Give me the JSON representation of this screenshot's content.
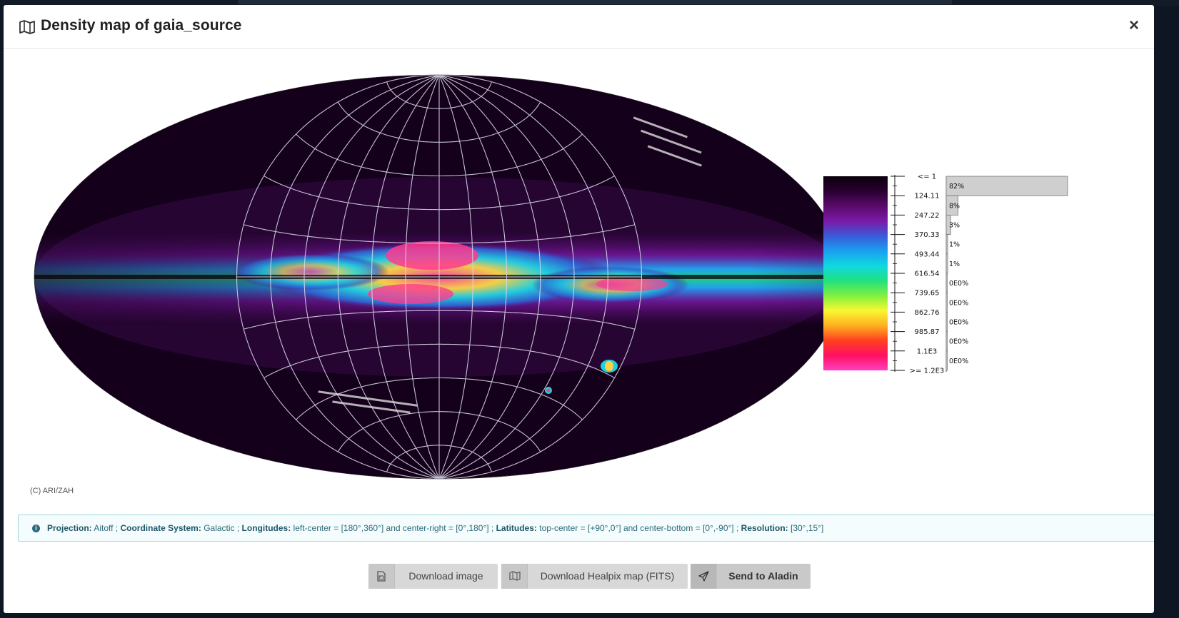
{
  "modal": {
    "title": "Density map of gaia_source",
    "header_icon": "map-icon",
    "close_label": "×",
    "copyright": "(C) ARI/ZAH"
  },
  "map": {
    "projection_shape": "aitoff",
    "colorscale": [
      "#0a000c",
      "#2a0030",
      "#5a0a6a",
      "#7a1aa8",
      "#3a5ad8",
      "#1aa0f0",
      "#10d8e0",
      "#20e080",
      "#80f040",
      "#f8f830",
      "#ffb020",
      "#ff4020",
      "#ff1060",
      "#ff40c0"
    ]
  },
  "legend": {
    "labels": [
      "<= 1",
      "124.11",
      "247.22",
      "370.33",
      "493.44",
      "616.54",
      "739.65",
      "862.76",
      "985.87",
      "1.1E3",
      ">= 1.2E3"
    ],
    "histogram": [
      {
        "pct_label": "82%",
        "value": 82
      },
      {
        "pct_label": "8%",
        "value": 8
      },
      {
        "pct_label": "3%",
        "value": 3
      },
      {
        "pct_label": "1%",
        "value": 1
      },
      {
        "pct_label": "1%",
        "value": 1
      },
      {
        "pct_label": "0E0%",
        "value": 0
      },
      {
        "pct_label": "0E0%",
        "value": 0
      },
      {
        "pct_label": "0E0%",
        "value": 0
      },
      {
        "pct_label": "0E0%",
        "value": 0
      },
      {
        "pct_label": "0E0%",
        "value": 0
      }
    ]
  },
  "info": {
    "icon": "info-circle-icon",
    "projection_label": "Projection:",
    "projection_value": "Aitoff ;",
    "coord_label": "Coordinate System:",
    "coord_value": "Galactic ;",
    "lon_label": "Longitudes:",
    "lon_value": "left-center = [180°,360°] and center-right = [0°,180°] ;",
    "lat_label": "Latitudes:",
    "lat_value": "top-center = [+90°,0°] and center-bottom = [0°,-90°] ;",
    "res_label": "Resolution:",
    "res_value": "[30°,15°]"
  },
  "buttons": {
    "download_image": {
      "label": "Download image",
      "icon": "image-file-icon"
    },
    "download_healpix": {
      "label": "Download Healpix map (FITS)",
      "icon": "map-icon"
    },
    "send_aladin": {
      "label": "Send to Aladin",
      "icon": "paper-plane-icon"
    }
  }
}
